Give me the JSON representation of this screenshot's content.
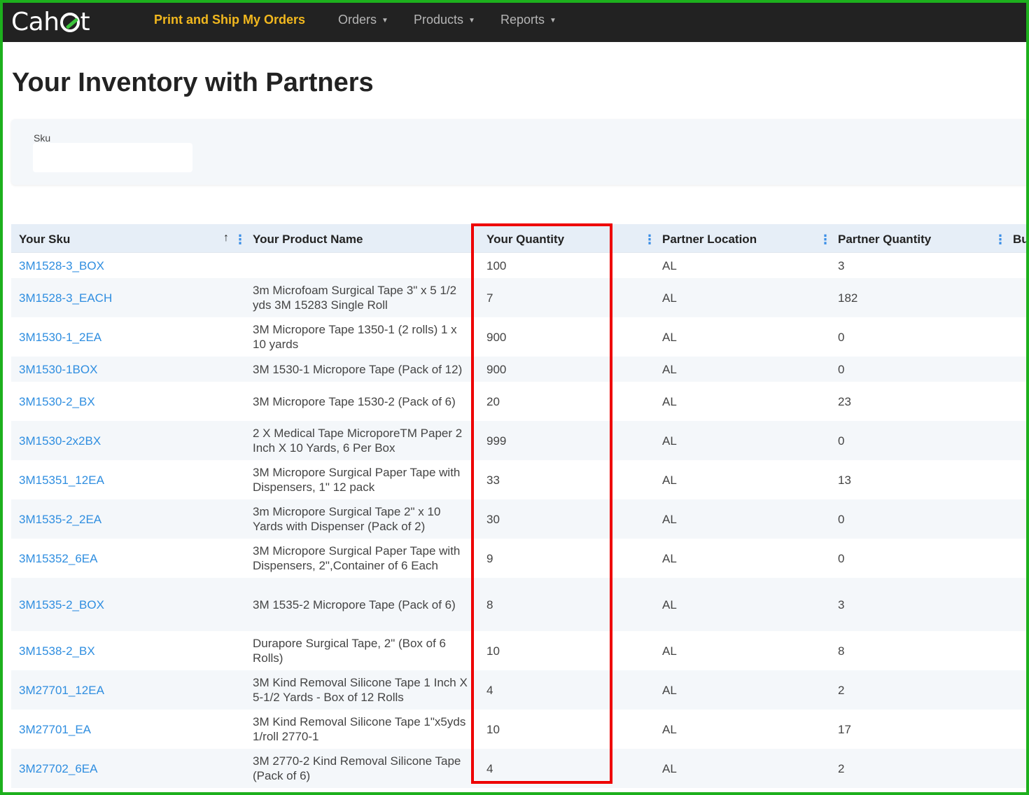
{
  "brand": {
    "logo_left": "Cah",
    "logo_right": "t"
  },
  "nav": {
    "active": "Print and Ship My Orders",
    "menus": [
      {
        "label": "Orders"
      },
      {
        "label": "Products"
      },
      {
        "label": "Reports"
      }
    ]
  },
  "page": {
    "title": "Your Inventory with Partners"
  },
  "filter": {
    "sku_label": "Sku",
    "sku_value": ""
  },
  "grid": {
    "columns": [
      "Your Sku",
      "Your Product Name",
      "Your Quantity",
      "Partner Location",
      "Partner Quantity",
      "Bu"
    ],
    "rows": [
      {
        "sku": "3M1528-3_BOX",
        "name": "",
        "qty": "100",
        "loc": "AL",
        "pqty": "3"
      },
      {
        "sku": "3M1528-3_EACH",
        "name": "3m Microfoam Surgical Tape 3\" x 5 1/2 yds 3M 15283 Single Roll",
        "qty": "7",
        "loc": "AL",
        "pqty": "182"
      },
      {
        "sku": "3M1530-1_2EA",
        "name": "3M Micropore Tape 1350-1 (2 rolls) 1 x 10 yards",
        "qty": "900",
        "loc": "AL",
        "pqty": "0"
      },
      {
        "sku": "3M1530-1BOX",
        "name": "3M 1530-1 Micropore Tape (Pack of 12)",
        "qty": "900",
        "loc": "AL",
        "pqty": "0"
      },
      {
        "sku": "3M1530-2_BX",
        "name": "3M Micropore Tape 1530-2 (Pack of 6)",
        "qty": "20",
        "loc": "AL",
        "pqty": "23"
      },
      {
        "sku": "3M1530-2x2BX",
        "name": "2 X Medical Tape MicroporeTM Paper 2 Inch X 10 Yards, 6 Per Box",
        "qty": "999",
        "loc": "AL",
        "pqty": "0"
      },
      {
        "sku": "3M15351_12EA",
        "name": "3M Micropore Surgical Paper Tape with Dispensers, 1\" 12 pack",
        "qty": "33",
        "loc": "AL",
        "pqty": "13"
      },
      {
        "sku": "3M1535-2_2EA",
        "name": "3m Micropore Surgical Tape 2\" x 10 Yards with Dispenser (Pack of 2)",
        "qty": "30",
        "loc": "AL",
        "pqty": "0"
      },
      {
        "sku": "3M15352_6EA",
        "name": "3M Micropore Surgical Paper Tape with Dispensers, 2\",Container of 6 Each",
        "qty": "9",
        "loc": "AL",
        "pqty": "0"
      },
      {
        "sku": "3M1535-2_BOX",
        "name": "3M 1535-2 Micropore Tape (Pack of 6)",
        "qty": "8",
        "loc": "AL",
        "pqty": "3"
      },
      {
        "sku": "3M1538-2_BX",
        "name": "Durapore Surgical Tape, 2\" (Box of 6 Rolls)",
        "qty": "10",
        "loc": "AL",
        "pqty": "8"
      },
      {
        "sku": "3M27701_12EA",
        "name": "3M Kind Removal Silicone Tape 1 Inch X 5-1/2 Yards - Box of 12 Rolls",
        "qty": "4",
        "loc": "AL",
        "pqty": "2"
      },
      {
        "sku": "3M27701_EA",
        "name": "3M Kind Removal Silicone Tape 1\"x5yds 1/roll 2770-1",
        "qty": "10",
        "loc": "AL",
        "pqty": "17"
      },
      {
        "sku": "3M27702_6EA",
        "name": "3M 2770-2 Kind Removal Silicone Tape (Pack of 6)",
        "qty": "4",
        "loc": "AL",
        "pqty": "2"
      }
    ]
  },
  "icons": {
    "sort": "sort-ascending-icon",
    "column_menu": "kebab-menu-icon",
    "dropdown": "caret-down-icon"
  },
  "colors": {
    "navbar": "#222222",
    "nav_active": "#f2b81e",
    "link": "#2f8ee0",
    "highlight": "#ee0000",
    "frame": "#1db01d"
  }
}
